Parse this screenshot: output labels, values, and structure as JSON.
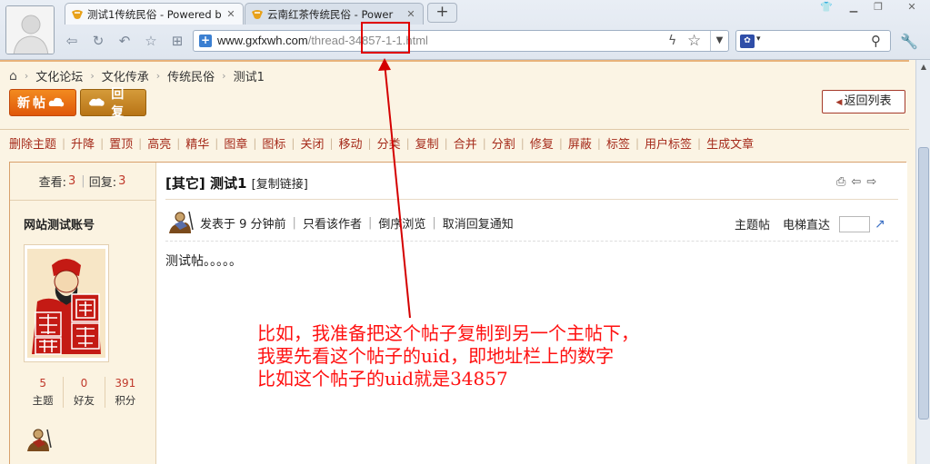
{
  "browser": {
    "tabs": [
      {
        "title": "测试1传统民俗 - Powered b",
        "active": true
      },
      {
        "title": "云南红茶传统民俗 - Power",
        "active": false
      }
    ],
    "new_tab_label": "+",
    "url": {
      "domain": "www.gxfxwh.com",
      "path": "/thread-34857-1-1.html"
    },
    "search": {
      "value": ""
    }
  },
  "page": {
    "breadcrumb": [
      "文化论坛",
      "文化传承",
      "传统民俗",
      "测试1"
    ],
    "buttons": {
      "new_post": "新帖",
      "reply": "回复",
      "back_to_list": "返回列表"
    },
    "admin_actions": [
      "删除主题",
      "升降",
      "置顶",
      "高亮",
      "精华",
      "图章",
      "图标",
      "关闭",
      "移动",
      "分类",
      "复制",
      "合并",
      "分割",
      "修复",
      "屏蔽",
      "标签",
      "用户标签",
      "生成文章"
    ],
    "thread_stats": {
      "view_label": "查看:",
      "views": "3",
      "reply_label": "回复:",
      "replies": "3"
    },
    "post": {
      "category": "[其它]",
      "title": "测试1",
      "copy_link": "[复制链接]",
      "meta": {
        "posted": "发表于 9 分钟前",
        "only_author": "只看该作者",
        "reverse": "倒序浏览",
        "cancel_notify": "取消回复通知",
        "thread_starter": "主题帖",
        "elevator": "电梯直达"
      },
      "body": "测试帖。。。。。"
    },
    "author": {
      "name": "网站测试账号",
      "extra": "",
      "stats": [
        {
          "value": "5",
          "label": "主题"
        },
        {
          "value": "0",
          "label": "好友"
        },
        {
          "value": "391",
          "label": "积分"
        }
      ]
    }
  },
  "annotation": {
    "lines": [
      "比如，我准备把这个帖子复制到另一个主帖下，",
      "我要先看这个帖子的uid，即地址栏上的数字",
      "比如这个帖子的uid就是34857"
    ],
    "color": "#ff1010"
  }
}
